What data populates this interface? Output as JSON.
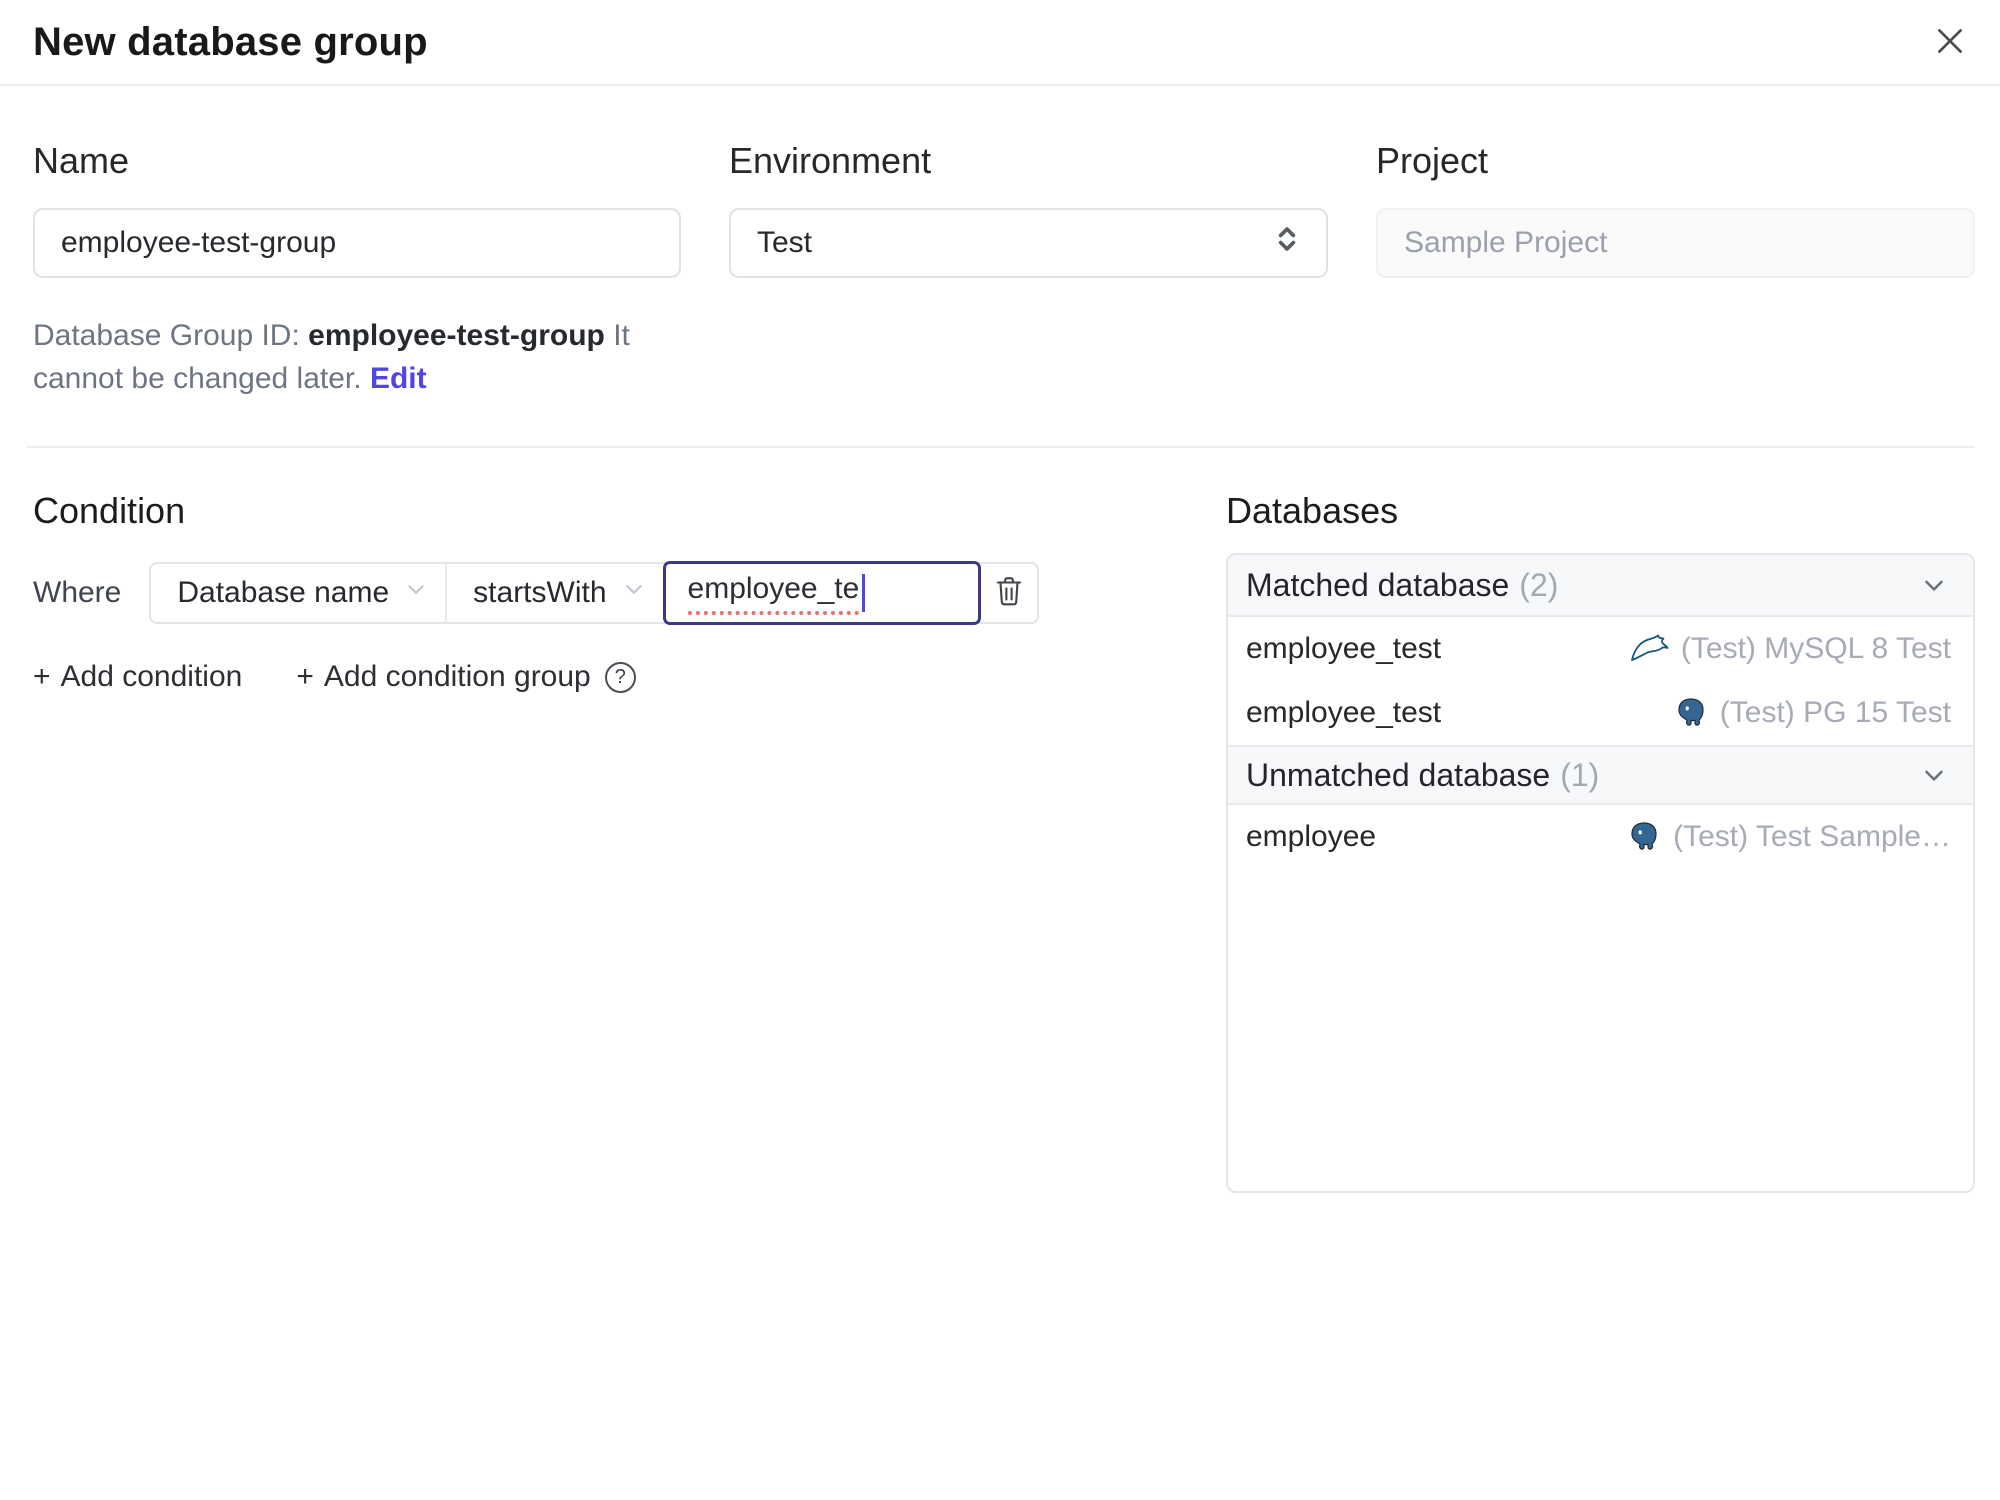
{
  "dialog": {
    "title": "New database group"
  },
  "form": {
    "name_label": "Name",
    "name_value": "employee-test-group",
    "environment_label": "Environment",
    "environment_value": "Test",
    "project_label": "Project",
    "project_value": "Sample Project",
    "id_note_prefix": "Database Group ID:",
    "id_note_id": "employee-test-group",
    "id_note_suffix": "It cannot be changed later.",
    "edit_link": "Edit"
  },
  "condition": {
    "heading": "Condition",
    "where_label": "Where",
    "factor_value": "Database name",
    "operator_value": "startsWith",
    "match_value": "employee_te",
    "add_condition": "Add condition",
    "add_condition_group": "Add condition group",
    "plus": "+",
    "help": "?"
  },
  "databases": {
    "heading": "Databases",
    "matched_title": "Matched database",
    "matched_count": "(2)",
    "unmatched_title": "Unmatched database",
    "unmatched_count": "(1)",
    "rows": [
      {
        "name": "employee_test",
        "instance": "(Test) MySQL 8 Test",
        "engine": "mysql"
      },
      {
        "name": "employee_test",
        "instance": "(Test) PG 15 Test",
        "engine": "postgresql"
      },
      {
        "name": "employee",
        "instance": "(Test) Test Sample…",
        "engine": "postgresql"
      }
    ]
  },
  "colors": {
    "accent": "#4f46e5",
    "focus_border": "#3b3a82",
    "spellcheck_underline": "#e57368",
    "mysql_icon": "#13557f",
    "postgresql_icon": "#336791",
    "header_bg": "#f7f8fa",
    "border": "#e4e6ea"
  }
}
